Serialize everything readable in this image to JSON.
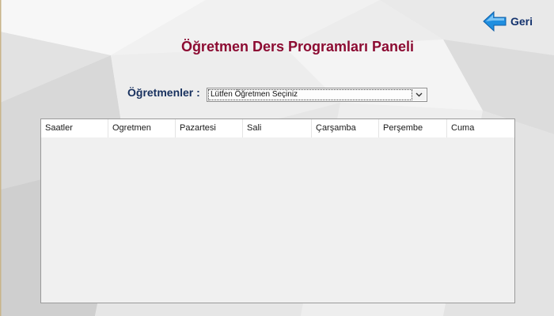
{
  "header": {
    "back_label": "Geri",
    "back_icon": "arrow-left-icon",
    "title": "Öğretmen Ders Programları Paneli"
  },
  "filter": {
    "label": "Öğretmenler :",
    "selected_value": "Lütfen Öğretmen Seçiniz",
    "dropdown_icon": "chevron-down-icon"
  },
  "schedule_grid": {
    "columns": [
      "Saatler",
      "Ogretmen",
      "Pazartesi",
      "Sali",
      "Çarşamba",
      "Perşembe",
      "Cuma"
    ],
    "rows": []
  },
  "colors": {
    "title": "#8c0b32",
    "label": "#17305e",
    "back_arrow": "#1f8fe0",
    "background": "#ececec"
  }
}
